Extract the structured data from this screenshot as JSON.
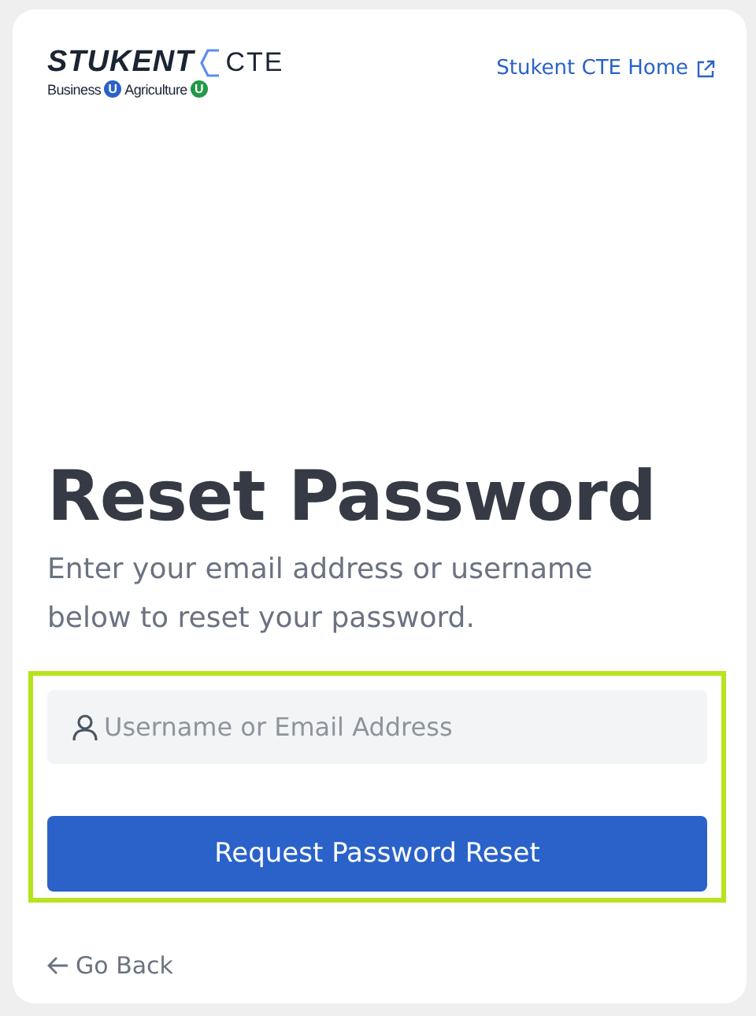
{
  "logo": {
    "wordmark": "STUKENT",
    "suffix": "CTE",
    "programs": [
      {
        "name": "Business",
        "badge": "U",
        "color": "#2a62c9"
      },
      {
        "name": "Agriculture",
        "badge": "U",
        "color": "#1f9a45"
      }
    ]
  },
  "home_link": "Stukent CTE Home",
  "title": "Reset Password",
  "subtitle": "Enter your email address or username below to reset your password.",
  "form": {
    "highlighted": true,
    "field": {
      "placeholder": "Username or Email Address"
    },
    "button": "Request Password Reset"
  },
  "back_link": "Go Back"
}
